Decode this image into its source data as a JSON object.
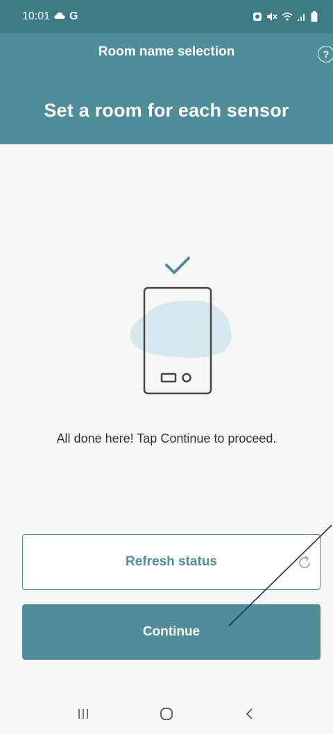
{
  "status_bar": {
    "time": "10:01",
    "left_icons": [
      "cloud-icon",
      "google-g-icon"
    ],
    "google_letter": "G",
    "right_icons": [
      "alarm-icon",
      "mute-icon",
      "wifi-icon",
      "signal-icon",
      "battery-icon"
    ]
  },
  "header": {
    "nav_title": "Room name selection",
    "help_label": "?",
    "page_title": "Set a room for each sensor"
  },
  "illustration": {
    "icons": [
      "checkmark-icon",
      "phone-icon"
    ]
  },
  "main": {
    "message": "All done here! Tap Continue to proceed."
  },
  "buttons": {
    "refresh_label": "Refresh status",
    "continue_label": "Continue"
  },
  "nav_bar": {
    "icons": [
      "recent-apps-icon",
      "home-icon",
      "back-icon"
    ]
  },
  "colors": {
    "primary": "#4e8d99",
    "status_bar": "#3c7a85",
    "background": "#f6f6f6",
    "blob": "#d6e8ef",
    "annotation": "#1b2a6b"
  }
}
